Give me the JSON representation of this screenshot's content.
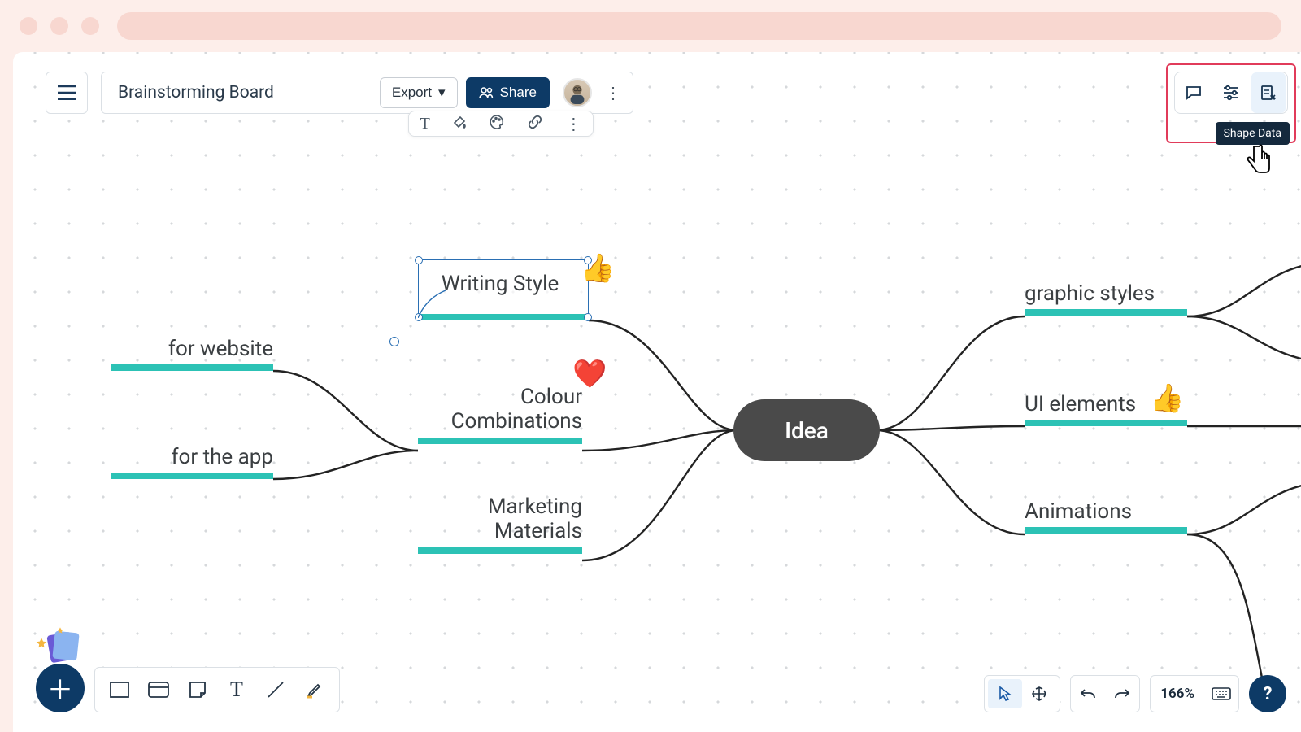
{
  "header": {
    "board_title": "Brainstorming Board",
    "export_label": "Export",
    "share_label": "Share"
  },
  "right_panel": {
    "tooltip": "Shape Data"
  },
  "mindmap": {
    "center": "Idea",
    "left1": {
      "writing_style": "Writing Style",
      "colour": "Colour\nCombinations",
      "marketing": "Marketing\nMaterials"
    },
    "left2": {
      "website": "for website",
      "app": "for the app"
    },
    "right": {
      "graphic": "graphic styles",
      "ui": "UI elements",
      "anim": "Animations"
    },
    "reactions": {
      "thumbs": "👍",
      "heart": "❤️"
    }
  },
  "bottom_right": {
    "zoom": "166%"
  }
}
